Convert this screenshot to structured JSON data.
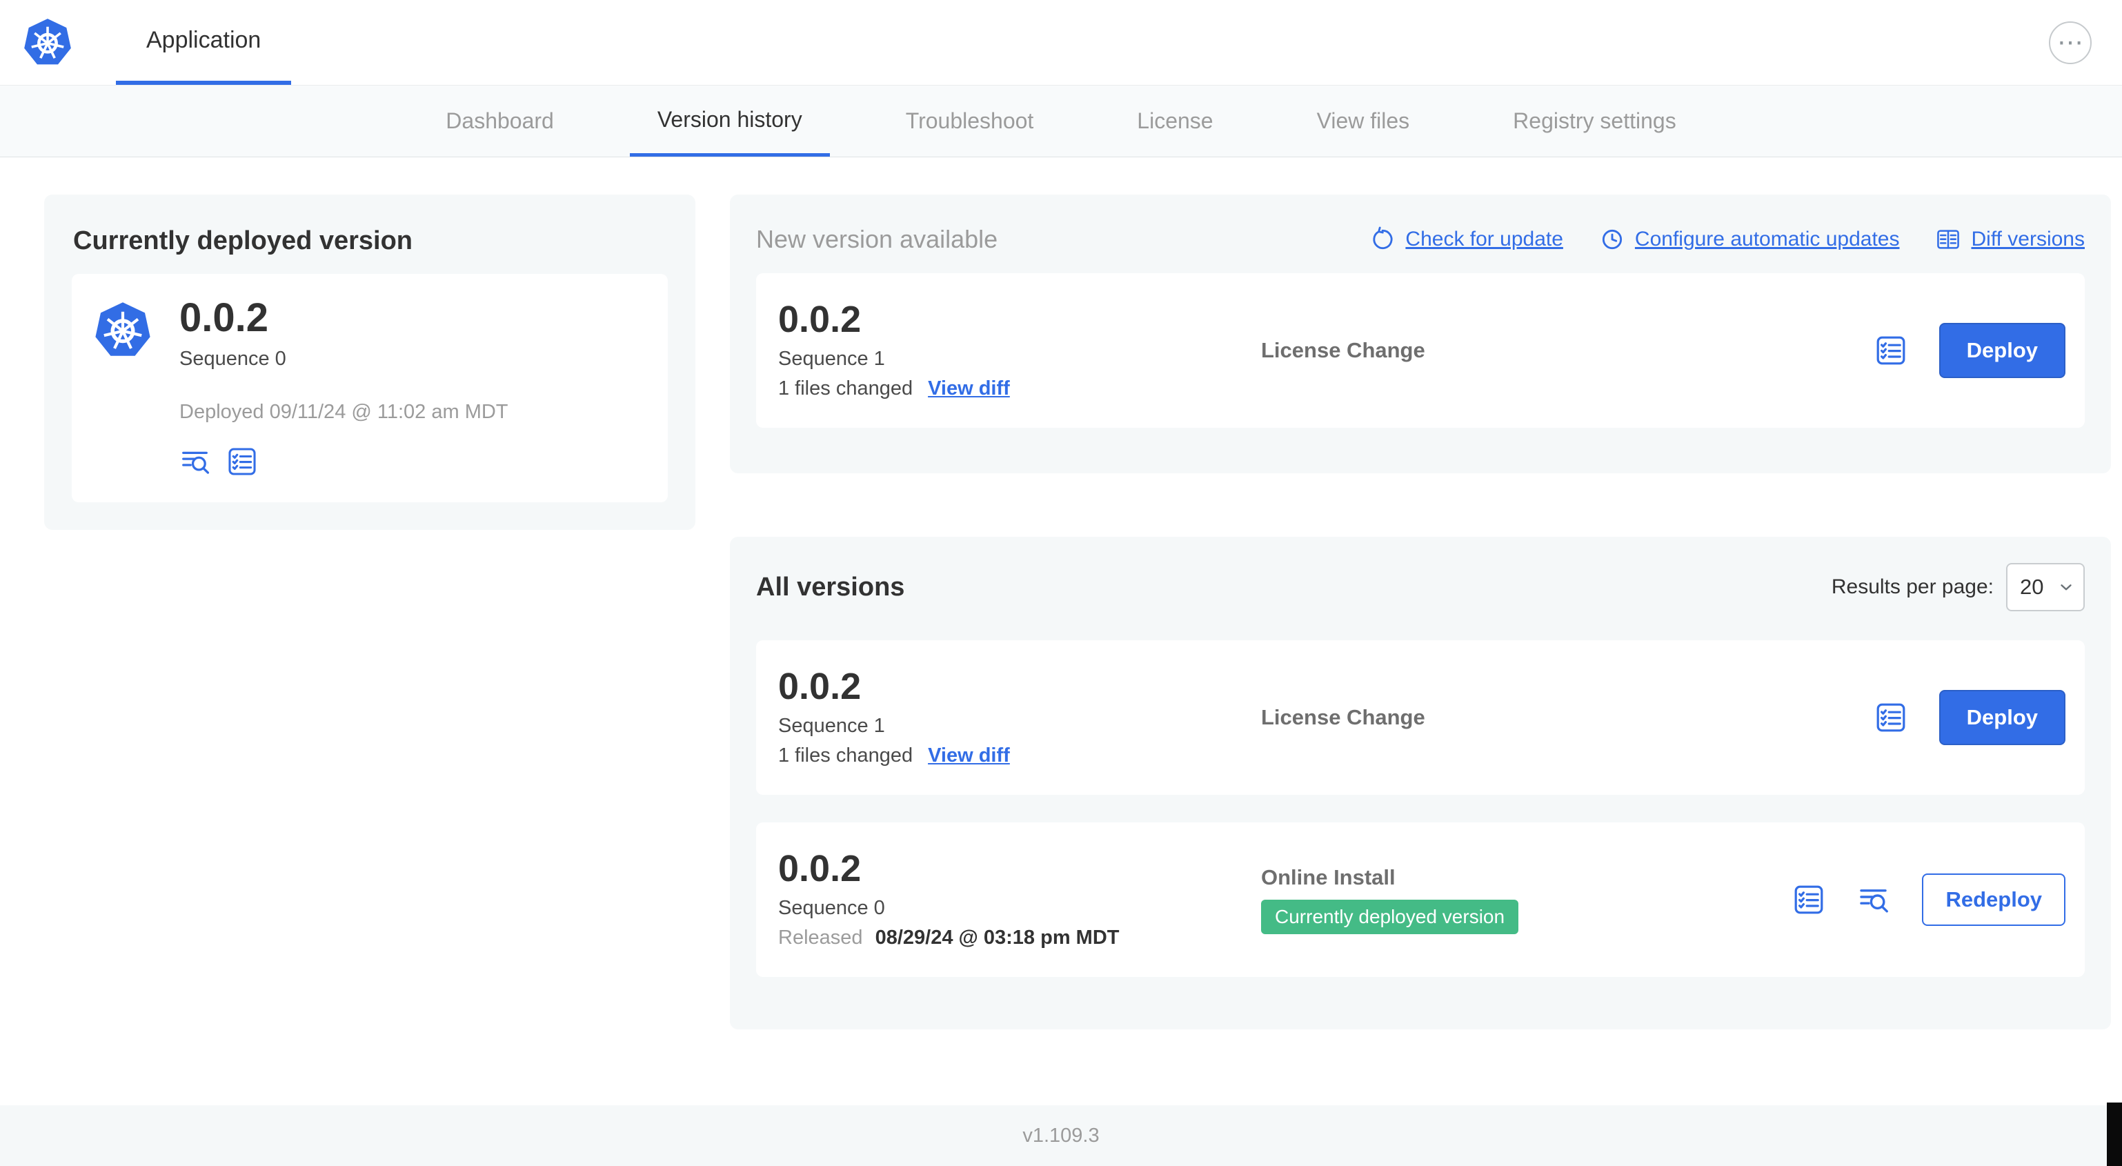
{
  "topbar": {
    "app_tab": "Application"
  },
  "nav": {
    "items": [
      {
        "label": "Dashboard",
        "active": false
      },
      {
        "label": "Version history",
        "active": true
      },
      {
        "label": "Troubleshoot",
        "active": false
      },
      {
        "label": "License",
        "active": false
      },
      {
        "label": "View files",
        "active": false
      },
      {
        "label": "Registry settings",
        "active": false
      }
    ]
  },
  "current_version": {
    "title": "Currently deployed version",
    "version": "0.0.2",
    "sequence": "Sequence 0",
    "deployed": "Deployed 09/11/24 @ 11:02 am MDT"
  },
  "new_version": {
    "title": "New version available",
    "check_for_update": "Check for update",
    "configure_updates": "Configure automatic updates",
    "diff_versions": "Diff versions",
    "row": {
      "version": "0.0.2",
      "sequence": "Sequence 1",
      "files_changed": "1 files changed",
      "view_diff": "View diff",
      "source": "License Change",
      "action": "Deploy"
    }
  },
  "all_versions": {
    "title": "All versions",
    "results_per_page_label": "Results per page:",
    "results_per_page_value": "20",
    "rows": [
      {
        "version": "0.0.2",
        "sequence": "Sequence 1",
        "files_changed": "1 files changed",
        "view_diff": "View diff",
        "source": "License Change",
        "action": "Deploy"
      },
      {
        "version": "0.0.2",
        "sequence": "Sequence 0",
        "released_label": "Released",
        "released_date": "08/29/24 @ 03:18 pm MDT",
        "source": "Online Install",
        "badge": "Currently deployed version",
        "action": "Redeploy"
      }
    ]
  },
  "footer": {
    "version": "v1.109.3"
  },
  "icons": {
    "more_options_glyph": "⋯",
    "kubernetes-logo": "blue heptagon with white helm wheel",
    "refresh-icon": "circular arrow",
    "schedule-icon": "clock",
    "diff-versions-icon": "split table",
    "preflight-checks-icon": "checklist in rounded square",
    "view-logs-icon": "text lines with magnifier",
    "chevron-down-icon": "chevron down"
  },
  "colors": {
    "accent_blue": "#326de6",
    "badge_green": "#44bb86",
    "card_bg": "#f5f8f9",
    "muted_text": "#9b9b9b"
  }
}
